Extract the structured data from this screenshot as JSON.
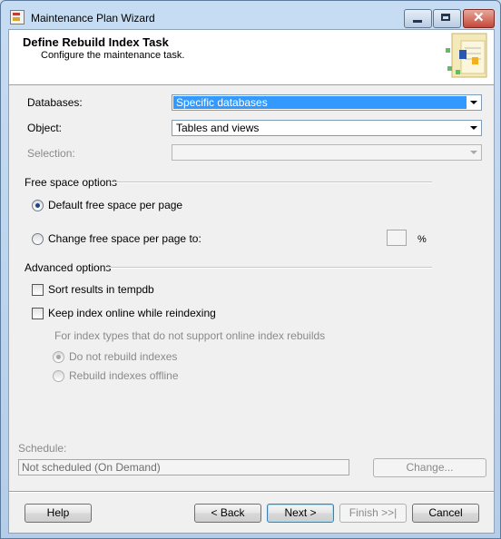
{
  "window": {
    "title": "Maintenance Plan Wizard"
  },
  "header": {
    "title": "Define Rebuild Index Task",
    "subtitle": "Configure the maintenance task."
  },
  "form": {
    "databases": {
      "label": "Databases:",
      "value": "Specific databases"
    },
    "object": {
      "label": "Object:",
      "value": "Tables and views"
    },
    "selection": {
      "label": "Selection:",
      "value": ""
    }
  },
  "free_space": {
    "title": "Free space options",
    "default_label": "Default free space per page",
    "change_label": "Change free space per page to:",
    "percent_value": "",
    "percent_unit": "%"
  },
  "advanced": {
    "title": "Advanced options",
    "sort_label": "Sort results in tempdb",
    "online_label": "Keep index online while reindexing",
    "online_note": "For index types that do not support online index rebuilds",
    "no_rebuild_label": "Do not rebuild indexes",
    "offline_label": "Rebuild indexes offline"
  },
  "schedule": {
    "label": "Schedule:",
    "value": "Not scheduled (On Demand)",
    "change_button": "Change..."
  },
  "buttons": {
    "help": "Help",
    "back": "< Back",
    "next": "Next >",
    "finish": "Finish >>|",
    "cancel": "Cancel"
  },
  "icons": [
    "app-icon",
    "minimize-icon",
    "maximize-icon",
    "close-icon",
    "wizard-graphic",
    "dropdown-arrow-icon"
  ],
  "colors": {
    "selection_highlight": "#3399ff",
    "window_frame": "#c6dcf3",
    "client_bg": "#f0f0f0"
  }
}
